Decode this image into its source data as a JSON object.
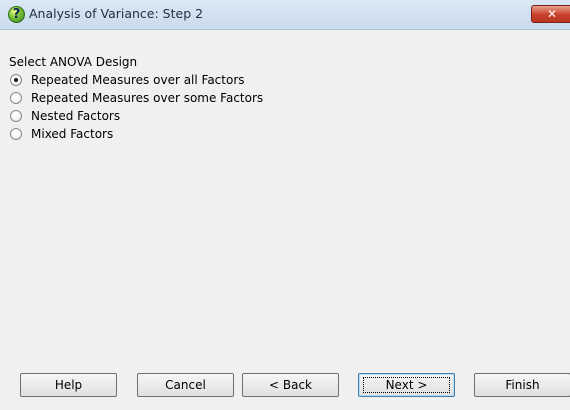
{
  "window": {
    "title": "Analysis of Variance: Step 2",
    "close_label": "✕",
    "help_icon_glyph": "?"
  },
  "design": {
    "section_label": "Select ANOVA Design",
    "options": [
      {
        "label": "Repeated Measures over all Factors",
        "checked": true
      },
      {
        "label": "Repeated Measures over some Factors",
        "checked": false
      },
      {
        "label": "Nested Factors",
        "checked": false
      },
      {
        "label": "Mixed Factors",
        "checked": false
      }
    ]
  },
  "buttons": {
    "help": "Help",
    "cancel": "Cancel",
    "back": "< Back",
    "next": "Next >",
    "finish": "Finish"
  },
  "colors": {
    "titlebar": "#c9dbee",
    "close": "#c8412b",
    "background": "#f0f0f0"
  },
  "icons": {
    "title": "question-help-icon",
    "close": "close-icon"
  }
}
